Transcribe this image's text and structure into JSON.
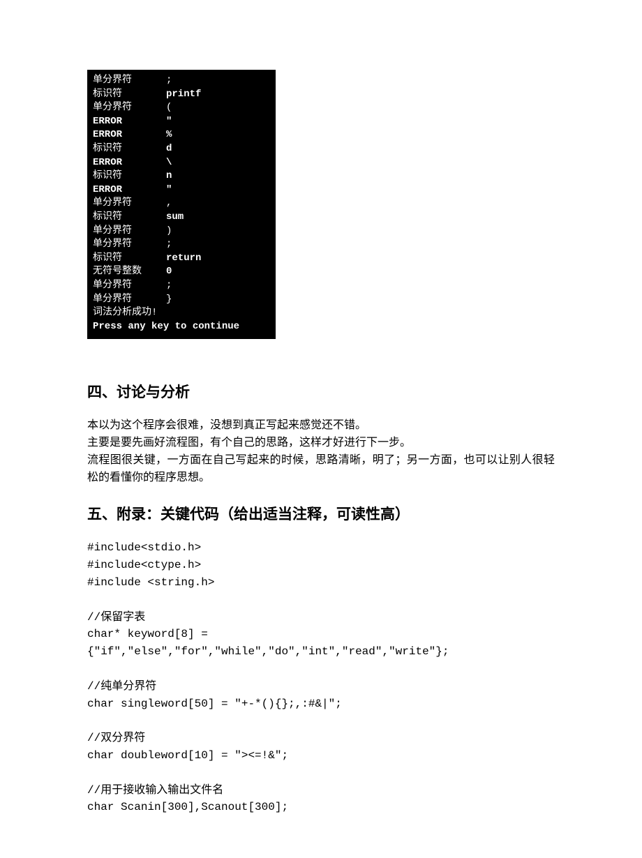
{
  "console": {
    "rows": [
      {
        "c1": "单分界符",
        "c2": ";",
        "bold": false
      },
      {
        "c1": "标识符",
        "c2": "printf",
        "bold": true
      },
      {
        "c1": "单分界符",
        "c2": "(",
        "bold": false
      },
      {
        "c1": "ERROR",
        "c2": "\"",
        "bold": true
      },
      {
        "c1": "ERROR",
        "c2": "%",
        "bold": true
      },
      {
        "c1": "标识符",
        "c2": "d",
        "bold": true
      },
      {
        "c1": "ERROR",
        "c2": "\\",
        "bold": true
      },
      {
        "c1": "标识符",
        "c2": "n",
        "bold": true
      },
      {
        "c1": "ERROR",
        "c2": "\"",
        "bold": true
      },
      {
        "c1": "单分界符",
        "c2": ",",
        "bold": false
      },
      {
        "c1": "标识符",
        "c2": "sum",
        "bold": true
      },
      {
        "c1": "单分界符",
        "c2": ")",
        "bold": false
      },
      {
        "c1": "单分界符",
        "c2": ";",
        "bold": false
      },
      {
        "c1": "标识符",
        "c2": "return",
        "bold": true
      },
      {
        "c1": "无符号整数",
        "c2": "0",
        "bold": true
      },
      {
        "c1": "单分界符",
        "c2": ";",
        "bold": false
      },
      {
        "c1": "单分界符",
        "c2": "}",
        "bold": false
      }
    ],
    "success": "词法分析成功!",
    "prompt": "Press any key to continue"
  },
  "section4": {
    "heading": "四、讨论与分析",
    "p1": "本以为这个程序会很难，没想到真正写起来感觉还不错。",
    "p2": "主要是要先画好流程图，有个自己的思路，这样才好进行下一步。",
    "p3": "流程图很关键，一方面在自己写起来的时候，思路清晰，明了；另一方面，也可以让别人很轻松的看懂你的程序思想。"
  },
  "section5": {
    "heading": "五、附录：关键代码（给出适当注释，可读性高）",
    "code": "#include<stdio.h>\n#include<ctype.h>\n#include <string.h>\n\n//保留字表\nchar* keyword[8] = {\"if\",\"else\",\"for\",\"while\",\"do\",\"int\",\"read\",\"write\"};\n\n//纯单分界符\nchar singleword[50] = \"+-*(){};,:#&|\";\n\n//双分界符\nchar doubleword[10] = \"><=!&\";\n\n//用于接收输入输出文件名\nchar Scanin[300],Scanout[300];"
  }
}
